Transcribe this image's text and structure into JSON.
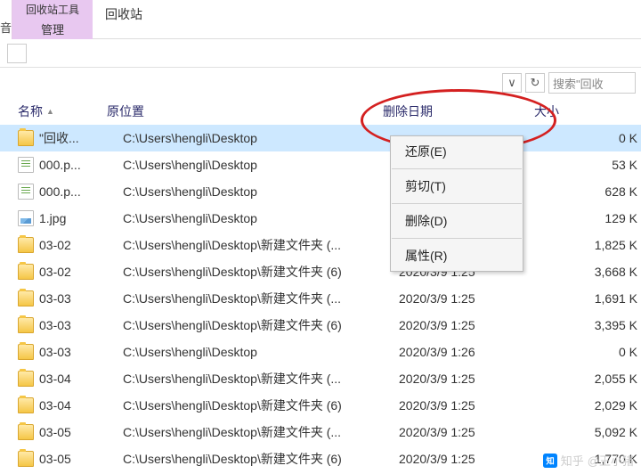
{
  "ribbon": {
    "tools_label": "回收站工具",
    "manage_label": "管理",
    "title": "回收站",
    "edge": "音"
  },
  "address": {
    "dropdown": "∨",
    "refresh": "↻",
    "search_placeholder": "搜索\"回收"
  },
  "columns": {
    "name": "名称",
    "location": "原位置",
    "date": "删除日期",
    "size": "大小"
  },
  "rows": [
    {
      "icon": "folder",
      "name": "\"回收...",
      "loc": "C:\\Users\\hengli\\Desktop",
      "date": "",
      "size": "0 K",
      "selected": true
    },
    {
      "icon": "file",
      "name": "000.p...",
      "loc": "C:\\Users\\hengli\\Desktop",
      "date": "",
      "size": "53 K"
    },
    {
      "icon": "file",
      "name": "000.p...",
      "loc": "C:\\Users\\hengli\\Desktop",
      "date": "",
      "size": "628 K"
    },
    {
      "icon": "img",
      "name": "1.jpg",
      "loc": "C:\\Users\\hengli\\Desktop",
      "date": "",
      "size": "129 K"
    },
    {
      "icon": "folder",
      "name": "03-02",
      "loc": "C:\\Users\\hengli\\Desktop\\新建文件夹 (...",
      "date": "",
      "size": "1,825 K"
    },
    {
      "icon": "folder",
      "name": "03-02",
      "loc": "C:\\Users\\hengli\\Desktop\\新建文件夹 (6)",
      "date": "2020/3/9 1:25",
      "size": "3,668 K"
    },
    {
      "icon": "folder",
      "name": "03-03",
      "loc": "C:\\Users\\hengli\\Desktop\\新建文件夹 (...",
      "date": "2020/3/9 1:25",
      "size": "1,691 K"
    },
    {
      "icon": "folder",
      "name": "03-03",
      "loc": "C:\\Users\\hengli\\Desktop\\新建文件夹 (6)",
      "date": "2020/3/9 1:25",
      "size": "3,395 K"
    },
    {
      "icon": "folder",
      "name": "03-03",
      "loc": "C:\\Users\\hengli\\Desktop",
      "date": "2020/3/9 1:26",
      "size": "0 K"
    },
    {
      "icon": "folder",
      "name": "03-04",
      "loc": "C:\\Users\\hengli\\Desktop\\新建文件夹 (...",
      "date": "2020/3/9 1:25",
      "size": "2,055 K"
    },
    {
      "icon": "folder",
      "name": "03-04",
      "loc": "C:\\Users\\hengli\\Desktop\\新建文件夹 (6)",
      "date": "2020/3/9 1:25",
      "size": "2,029 K"
    },
    {
      "icon": "folder",
      "name": "03-05",
      "loc": "C:\\Users\\hengli\\Desktop\\新建文件夹 (...",
      "date": "2020/3/9 1:25",
      "size": "5,092 K"
    },
    {
      "icon": "folder",
      "name": "03-05",
      "loc": "C:\\Users\\hengli\\Desktop\\新建文件夹 (6)",
      "date": "2020/3/9 1:25",
      "size": "1,770 K"
    }
  ],
  "context_menu": {
    "restore": "还原(E)",
    "cut": "剪切(T)",
    "delete": "删除(D)",
    "properties": "属性(R)"
  },
  "watermark": {
    "brand": "知乎",
    "user": "@王小猪"
  }
}
